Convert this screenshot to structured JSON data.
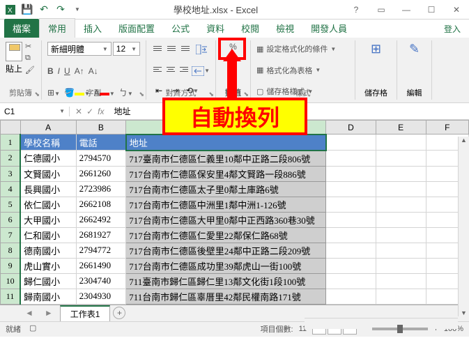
{
  "title": "學校地址.xlsx - Excel",
  "tabs": {
    "file": "檔案",
    "home": "常用",
    "insert": "插入",
    "layout": "版面配置",
    "formulas": "公式",
    "data": "資料",
    "review": "校閱",
    "view": "檢視",
    "dev": "開發人員",
    "login": "登入"
  },
  "ribbon": {
    "paste": "貼上",
    "clipboard": "剪貼簿",
    "font": "字型",
    "font_name": "新細明體",
    "font_size": "12",
    "align": "對齊方式",
    "number": "數值",
    "num_label": "數值",
    "styles": "樣式",
    "cond": "設定格式化的條件",
    "table": "格式化為表格",
    "cell_style": "儲存格樣式",
    "cells": "儲存格",
    "edit": "編輯"
  },
  "callout": "自動換列",
  "name_box": "C1",
  "formula": "地址",
  "cols": [
    "A",
    "B",
    "C",
    "D",
    "E",
    "F"
  ],
  "headers": {
    "a": "學校名稱",
    "b": "電話",
    "c": "地址"
  },
  "rows": [
    {
      "a": "仁德國小",
      "b": "2794570",
      "c": "717臺南市仁德區仁義里10鄰中正路二段806號"
    },
    {
      "a": "文賢國小",
      "b": "2661260",
      "c": "717台南市仁德區保安里4鄰文賢路一段886號"
    },
    {
      "a": "長興國小",
      "b": "2723986",
      "c": "717台南市仁德區太子里0鄰土庫路6號"
    },
    {
      "a": "依仁國小",
      "b": "2662108",
      "c": "717台南市仁德區中洲里1鄰中洲1-126號"
    },
    {
      "a": "大甲國小",
      "b": "2662492",
      "c": "717台南市仁德區大甲里0鄰中正西路360巷30號"
    },
    {
      "a": "仁和國小",
      "b": "2681927",
      "c": "717台南市仁德區仁愛里22鄰保仁路68號"
    },
    {
      "a": "德南國小",
      "b": "2794772",
      "c": "717台南市仁德區後壁里24鄰中正路二段209號"
    },
    {
      "a": "虎山實小",
      "b": "2661490",
      "c": "717台南市仁德區成功里39鄰虎山一街100號"
    },
    {
      "a": "歸仁國小",
      "b": "2304740",
      "c": "711臺南市歸仁區歸仁里13鄰文化街1段100號"
    },
    {
      "a": "歸南國小",
      "b": "2304930",
      "c": "711台南市歸仁區辜厝里42鄰民權南路171號"
    }
  ],
  "sheet": "工作表1",
  "status": {
    "ready": "就緒",
    "count_label": "項目個數:",
    "count": "11",
    "zoom": "100%"
  }
}
